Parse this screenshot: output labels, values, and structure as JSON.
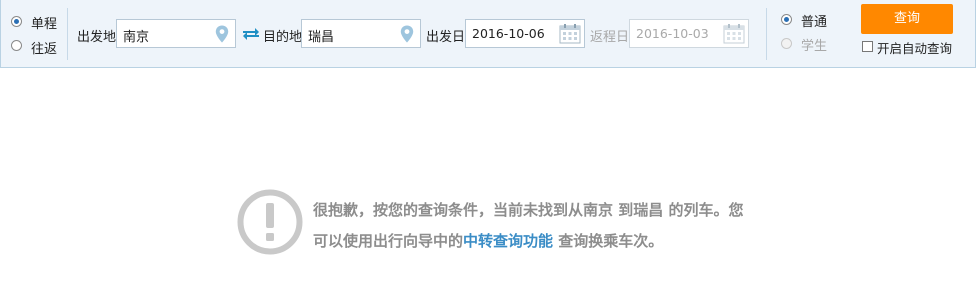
{
  "trip_type": {
    "one_way": "单程",
    "round_trip": "往返"
  },
  "from": {
    "label": "出发地",
    "value": "南京"
  },
  "to": {
    "label": "目的地",
    "value": "瑞昌"
  },
  "depart": {
    "label": "出发日",
    "value": "2016-10-06"
  },
  "return": {
    "label": "返程日",
    "value": "2016-10-03"
  },
  "ticket_type": {
    "normal": "普通",
    "student": "学生"
  },
  "query_button": "查询",
  "auto_query_label": "开启自动查询",
  "message": {
    "text1": "很抱歉，按您的查询条件，当前未找到从南京 到瑞昌 的列车。您可以使用出行向导中的",
    "link": "中转查询功能",
    "text2": " 查询换乘车次。"
  },
  "colors": {
    "accent": "#ff8800",
    "link": "#3b8dc6",
    "bar_bg": "#eef4fa"
  }
}
